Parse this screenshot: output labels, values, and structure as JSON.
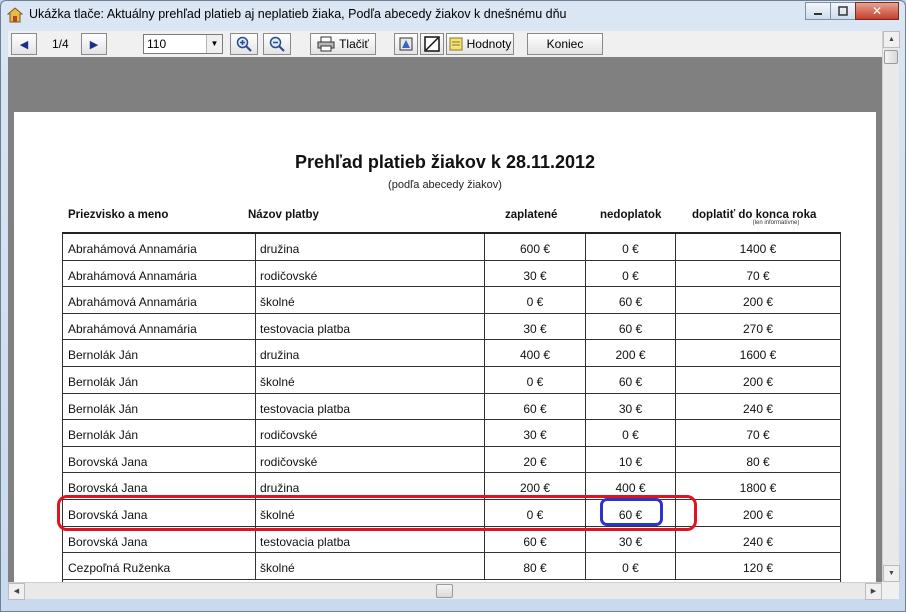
{
  "window": {
    "title": "Ukážka tlače: Aktuálny prehľad platieb aj neplatieb žiaka, Podľa abecedy žiakov k dnešnému dňu",
    "minimize_icon": "minimize-icon",
    "maximize_icon": "maximize-icon",
    "close_label": "✕"
  },
  "toolbar": {
    "prev_glyph": "◀",
    "next_glyph": "▶",
    "page_indicator": "1/4",
    "zoom_value": "110",
    "print_label": "Tlačiť",
    "values_label": "Hodnoty",
    "close_label": "Koniec"
  },
  "report": {
    "title": "Prehľad platieb žiakov k 28.11.2012",
    "subtitle": "(podľa abecedy žiakov)",
    "columns": {
      "name": "Priezvisko a meno",
      "payment": "Názov platby",
      "paid": "zaplatené",
      "unpaid": "nedoplatok",
      "due": "doplatiť do konca roka",
      "due_note": "(len informatívne)"
    },
    "rows": [
      {
        "name": "Abrahámová Annamária",
        "payment": "družina",
        "paid": "600 €",
        "unpaid": "0 €",
        "due": "1400 €"
      },
      {
        "name": "Abrahámová Annamária",
        "payment": "rodičovské",
        "paid": "30 €",
        "unpaid": "0 €",
        "due": "70 €"
      },
      {
        "name": "Abrahámová Annamária",
        "payment": "školné",
        "paid": "0 €",
        "unpaid": "60 €",
        "due": "200 €"
      },
      {
        "name": "Abrahámová Annamária",
        "payment": "testovacia platba",
        "paid": "30 €",
        "unpaid": "60 €",
        "due": "270 €"
      },
      {
        "name": "Bernolák Ján",
        "payment": "družina",
        "paid": "400 €",
        "unpaid": "200 €",
        "due": "1600 €"
      },
      {
        "name": "Bernolák Ján",
        "payment": "školné",
        "paid": "0 €",
        "unpaid": "60 €",
        "due": "200 €"
      },
      {
        "name": "Bernolák Ján",
        "payment": "testovacia platba",
        "paid": "60 €",
        "unpaid": "30 €",
        "due": "240 €"
      },
      {
        "name": "Bernolák Ján",
        "payment": "rodičovské",
        "paid": "30 €",
        "unpaid": "0 €",
        "due": "70 €"
      },
      {
        "name": "Borovská Jana",
        "payment": "rodičovské",
        "paid": "20 €",
        "unpaid": "10 €",
        "due": "80 €"
      },
      {
        "name": "Borovská Jana",
        "payment": "družina",
        "paid": "200 €",
        "unpaid": "400 €",
        "due": "1800 €"
      },
      {
        "name": "Borovská Jana",
        "payment": "školné",
        "paid": "0 €",
        "unpaid": "60 €",
        "due": "200 €"
      },
      {
        "name": "Borovská Jana",
        "payment": "testovacia platba",
        "paid": "60 €",
        "unpaid": "30 €",
        "due": "240 €"
      },
      {
        "name": "Cezpoľná Ruženka",
        "payment": "školné",
        "paid": "80 €",
        "unpaid": "0 €",
        "due": "120 €"
      }
    ]
  }
}
